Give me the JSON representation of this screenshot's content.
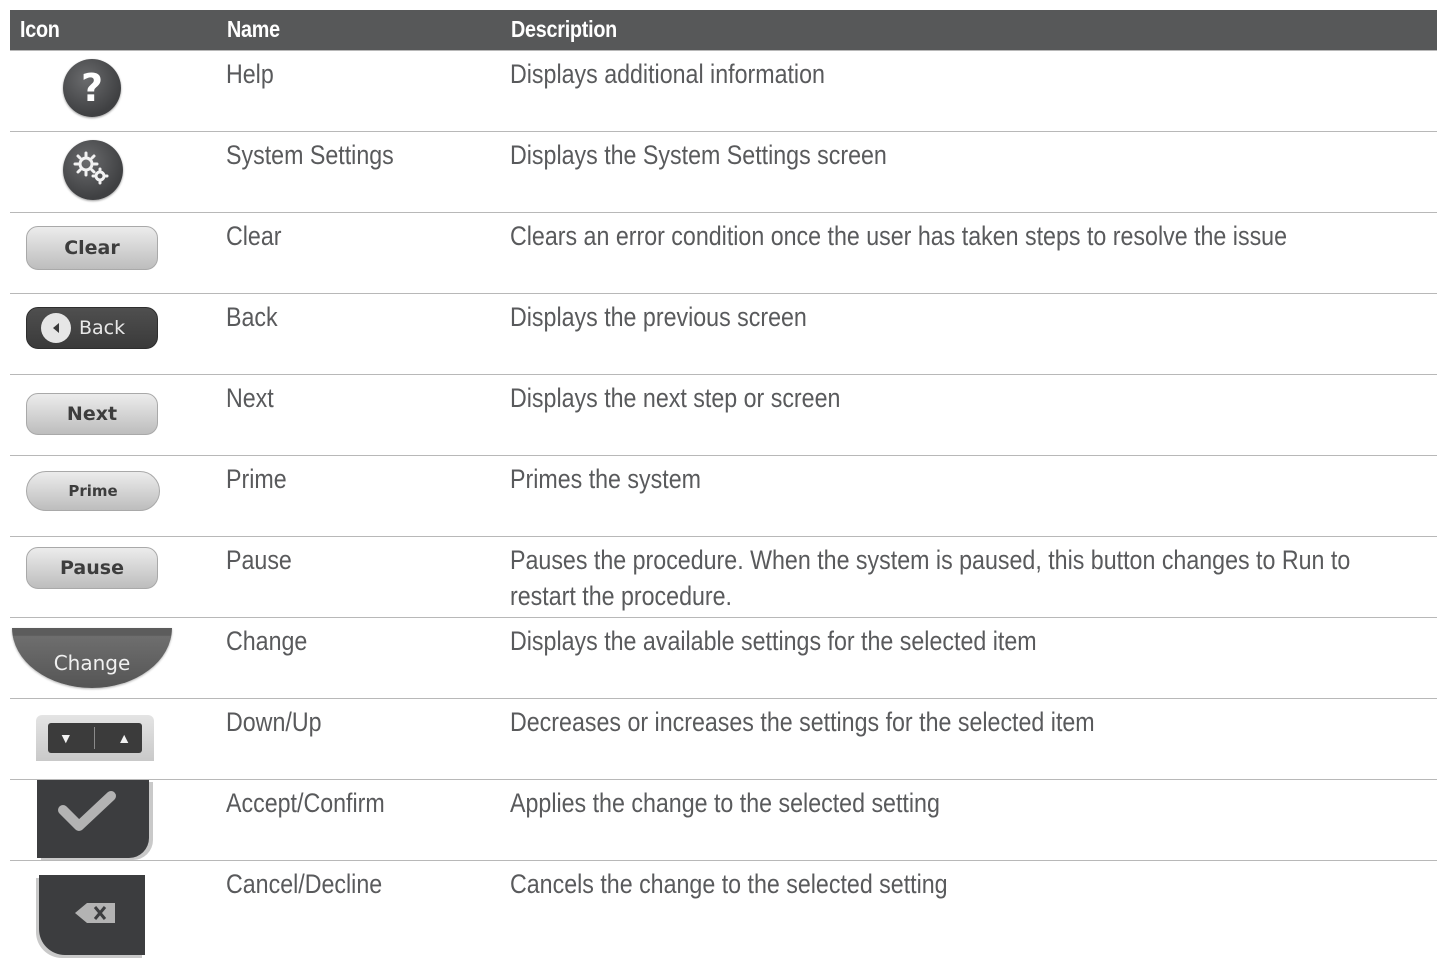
{
  "header": {
    "icon_col": "Icon",
    "name_col": "Name",
    "desc_col": "Description"
  },
  "rows": [
    {
      "icon": "help-icon",
      "icon_label": "?",
      "name": "Help",
      "description": "Displays additional information"
    },
    {
      "icon": "gears-icon",
      "icon_label": "",
      "name": "System Settings",
      "description": "Displays the System Settings screen"
    },
    {
      "icon": "clear-button-icon",
      "icon_label": "Clear",
      "name": "Clear",
      "description": "Clears an error condition once the user has taken steps to resolve the issue"
    },
    {
      "icon": "back-button-icon",
      "icon_label": "Back",
      "name": "Back",
      "description": "Displays the previous screen"
    },
    {
      "icon": "next-button-icon",
      "icon_label": "Next",
      "name": "Next",
      "description": "Displays the next step or screen"
    },
    {
      "icon": "prime-button-icon",
      "icon_label": "Prime",
      "name": "Prime",
      "description": "Primes the system"
    },
    {
      "icon": "pause-button-icon",
      "icon_label": "Pause",
      "name": "Pause",
      "description": "Pauses the procedure. When the system is paused, this button changes to Run to restart the procedure."
    },
    {
      "icon": "change-button-icon",
      "icon_label": "Change",
      "name": "Change",
      "description": "Displays the available settings for the selected item"
    },
    {
      "icon": "down-up-icon",
      "icon_label": "",
      "name": "Down/Up",
      "description": "Decreases or increases the settings for the selected item"
    },
    {
      "icon": "checkmark-icon",
      "icon_label": "",
      "name": "Accept/Confirm",
      "description": "Applies the change to the selected setting"
    },
    {
      "icon": "backspace-x-icon",
      "icon_label": "",
      "name": "Cancel/Decline",
      "description": "Cancels the change to the selected setting"
    }
  ]
}
